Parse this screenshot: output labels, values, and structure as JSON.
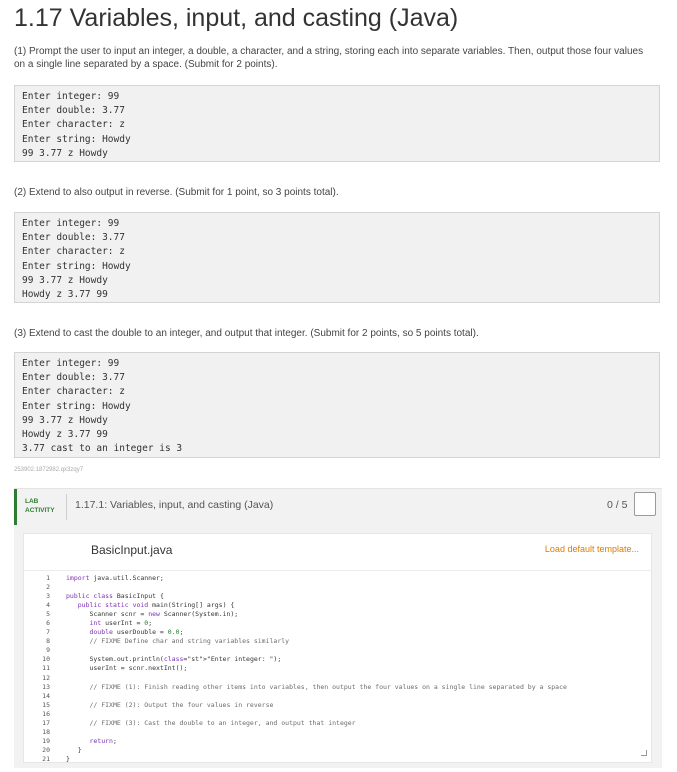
{
  "page": {
    "title": "1.17 Variables, input, and casting (Java)"
  },
  "step1": {
    "instruction": "(1) Prompt the user to input an integer, a double, a character, and a string, storing each into separate variables. Then, output those four values on a single line separated by a space. (Submit for 2 points).",
    "output": [
      "Enter integer: 99",
      "Enter double: 3.77",
      "Enter character: z",
      "Enter string: Howdy",
      "99 3.77 z Howdy"
    ]
  },
  "step2": {
    "instruction": "(2) Extend to also output in reverse. (Submit for 1 point, so 3 points total).",
    "output": [
      "Enter integer: 99",
      "Enter double: 3.77",
      "Enter character: z",
      "Enter string: Howdy",
      "99 3.77 z Howdy",
      "Howdy z 3.77 99"
    ]
  },
  "step3": {
    "instruction": "(3) Extend to cast the double to an integer, and output that integer. (Submit for 2 points, so 5 points total).",
    "output": [
      "Enter integer: 99",
      "Enter double: 3.77",
      "Enter character: z",
      "Enter string: Howdy",
      "99 3.77 z Howdy",
      "Howdy z 3.77 99",
      "3.77 cast to an integer is 3"
    ]
  },
  "footnote": "253902.1872982.qx3zqy7",
  "lab": {
    "tag_line1": "LAB",
    "tag_line2": "ACTIVITY",
    "name": "1.17.1: Variables, input, and casting (Java)",
    "score": "0 / 5",
    "accent_color": "#2e7d32"
  },
  "editor": {
    "filename": "BasicInput.java",
    "load_template_label": "Load default template...",
    "line_numbers": [
      "1",
      "2",
      "3",
      "4",
      "5",
      "6",
      "7",
      "8",
      "9",
      "10",
      "11",
      "12",
      "13",
      "14",
      "15",
      "16",
      "17",
      "18",
      "19",
      "20",
      "21"
    ],
    "code": [
      "import java.util.Scanner;",
      "",
      "public class BasicInput {",
      "   public static void main(String[] args) {",
      "      Scanner scnr = new Scanner(System.in);",
      "      int userInt = 0;",
      "      double userDouble = 0.0;",
      "      // FIXME Define char and string variables similarly",
      "",
      "      System.out.println(\"Enter integer: \");",
      "      userInt = scnr.nextInt();",
      "",
      "      // FIXME (1): Finish reading other items into variables, then output the four values on a single line separated by a space",
      "",
      "      // FIXME (2): Output the four values in reverse",
      "",
      "      // FIXME (3): Cast the double to an integer, and output that integer",
      "",
      "      return;",
      "   }",
      "}"
    ]
  }
}
